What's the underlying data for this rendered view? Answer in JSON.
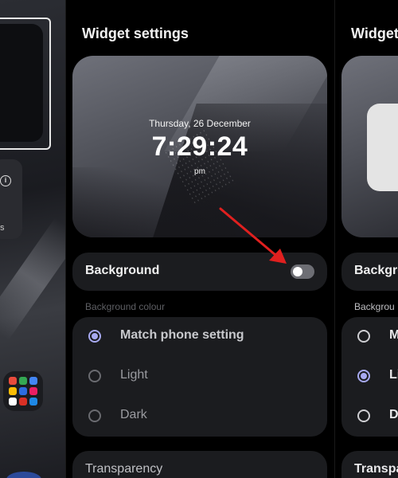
{
  "left_panel": {
    "info_icon_glyph": "i",
    "partial_text": "s"
  },
  "center_panel": {
    "title": "Widget settings",
    "preview": {
      "date": "Thursday, 26 December",
      "time": "7:29:24",
      "ampm": "pm"
    },
    "background_row": {
      "label": "Background",
      "toggle_on": false
    },
    "background_colour": {
      "section_label": "Background colour",
      "options": [
        {
          "label": "Match phone setting",
          "selected": true
        },
        {
          "label": "Light",
          "selected": false
        },
        {
          "label": "Dark",
          "selected": false
        }
      ]
    },
    "transparency": {
      "label": "Transparency"
    }
  },
  "right_panel": {
    "title": "Widget",
    "background_row_label": "Backgro",
    "section_label": "Backgrou",
    "options": [
      {
        "label": "M",
        "selected": false
      },
      {
        "label": "Li",
        "selected": true
      },
      {
        "label": "D",
        "selected": false
      }
    ],
    "transparency_label": "Transpa"
  },
  "colors": {
    "accent_radio": "#a7a9f0",
    "annotation_arrow": "#e0201f",
    "card_bg": "#1b1c1f"
  }
}
